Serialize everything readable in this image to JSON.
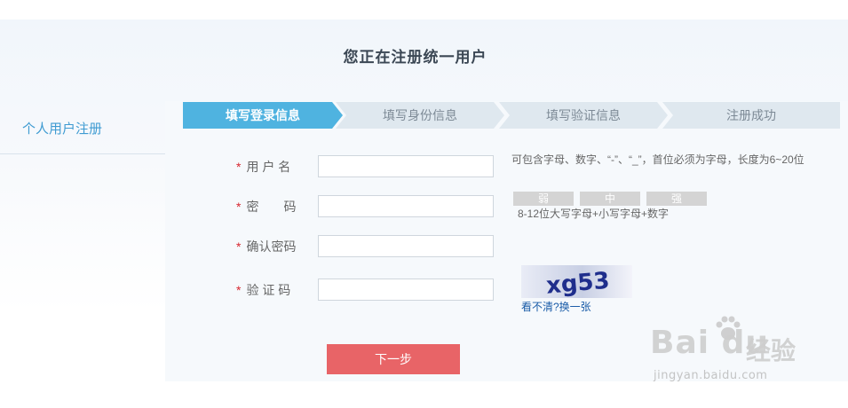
{
  "page": {
    "title": "您正在注册统一用户"
  },
  "sidebar": {
    "items": [
      {
        "label": "个人用户注册"
      }
    ]
  },
  "steps": [
    {
      "label": "填写登录信息",
      "active": true
    },
    {
      "label": "填写身份信息",
      "active": false
    },
    {
      "label": "填写验证信息",
      "active": false
    },
    {
      "label": "注册成功",
      "active": false
    }
  ],
  "form": {
    "required_mark": "*",
    "username": {
      "label": "用 户 名",
      "value": "",
      "hint": "可包含字母、数字、“-”、“_”，首位必须为字母，长度为6~20位"
    },
    "password": {
      "label": "密　　码",
      "value": "",
      "strength": [
        "弱",
        "中",
        "强"
      ],
      "hint": "8-12位大写字母+小写字母+数字"
    },
    "confirm_password": {
      "label": "确认密码",
      "value": ""
    },
    "captcha": {
      "label": "验 证 码",
      "value": "",
      "image_text": "xg53",
      "refresh_link": "看不清?换一张"
    },
    "next_button": "下一步"
  },
  "watermark": {
    "logo": "Bai du",
    "brand": "经验",
    "url": "jingyan.baidu.com"
  },
  "colors": {
    "accent_blue": "#4fb3e0",
    "step_inactive": "#dfe8ef",
    "button_red": "#e86467",
    "required_red": "#d7262f",
    "link_blue": "#1a5ca8"
  }
}
